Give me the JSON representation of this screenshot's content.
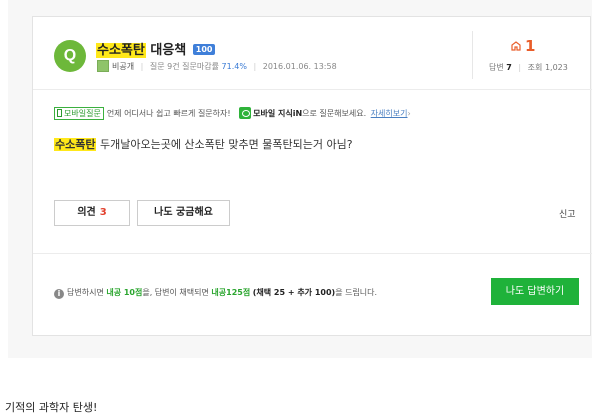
{
  "question": {
    "badge": "Q",
    "keyword": "수소폭탄",
    "title_rest": " 대응책",
    "answer_count_badge": "100",
    "author": "비공개",
    "meta_question_label": "질문 9건",
    "meta_deadline_label": "질문마감률",
    "meta_deadline_value": "71.4%",
    "date": "2016.01.06. 13:58",
    "body_rest": " 두개날아오는곳에 산소폭탄 맞추면 물폭탄되는거 아님?"
  },
  "stats": {
    "like_count": "1",
    "answers_label": "답변",
    "answers_value": "7",
    "views_label": "조회",
    "views_value": "1,023"
  },
  "mobile": {
    "tag": "모바일질문",
    "text": "언제 어디서나 쉽고 빠르게 질문하자!",
    "app_name": "모바일 지식iN",
    "app_suffix": "으로 질문해보세요.",
    "more_link": "자세히보기"
  },
  "actions": {
    "opinion_label": "의견",
    "opinion_count": "3",
    "curious_label": "나도 궁금해요",
    "report_label": "신고"
  },
  "reward": {
    "t1": "답변하시면",
    "t2": "내공 10점",
    "t3": "을, 답변이 채택되면",
    "t4": "내공125점",
    "t5": "(채택 25 + 추가 100)",
    "t6": "을 드립니다."
  },
  "answer_button": "나도 답변하기",
  "caption": "기적의 과학자 탄생!"
}
